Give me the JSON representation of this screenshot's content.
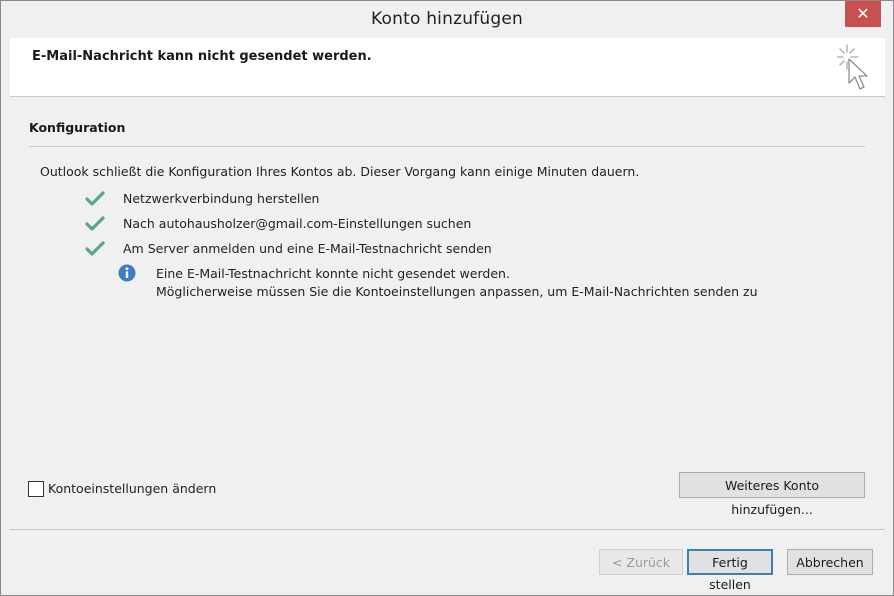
{
  "window": {
    "title": "Konto hinzufügen",
    "close_glyph": "✕"
  },
  "header": {
    "message": "E-Mail-Nachricht kann nicht gesendet werden.",
    "icon": "wizard-cursor-icon"
  },
  "section": {
    "title": "Konfiguration",
    "intro": "Outlook schließt die Konfiguration Ihres Kontos ab. Dieser Vorgang kann einige Minuten dauern."
  },
  "steps": [
    {
      "label": "Netzwerkverbindung herstellen",
      "status": "done"
    },
    {
      "label": "Nach autohausholzer@gmail.com-Einstellungen suchen",
      "status": "done"
    },
    {
      "label": "Am Server anmelden und eine E-Mail-Testnachricht senden",
      "status": "done"
    }
  ],
  "info": {
    "line1": "Eine E-Mail-Testnachricht konnte nicht gesendet werden.",
    "line2": "Möglicherweise müssen Sie die Kontoeinstellungen anpassen, um E-Mail-Nachrichten senden zu"
  },
  "options": {
    "change_settings_label": "Kontoeinstellungen ändern",
    "change_settings_checked": false,
    "add_another_label": "Weiteres Konto hinzufügen..."
  },
  "footer": {
    "back_label": "< Zurück",
    "finish_label": "Fertig stellen",
    "cancel_label": "Abbrechen"
  },
  "colors": {
    "check": "#5aa68a",
    "info": "#3f7cc0",
    "close": "#c75050",
    "default_button_border": "#3c7fb1"
  }
}
